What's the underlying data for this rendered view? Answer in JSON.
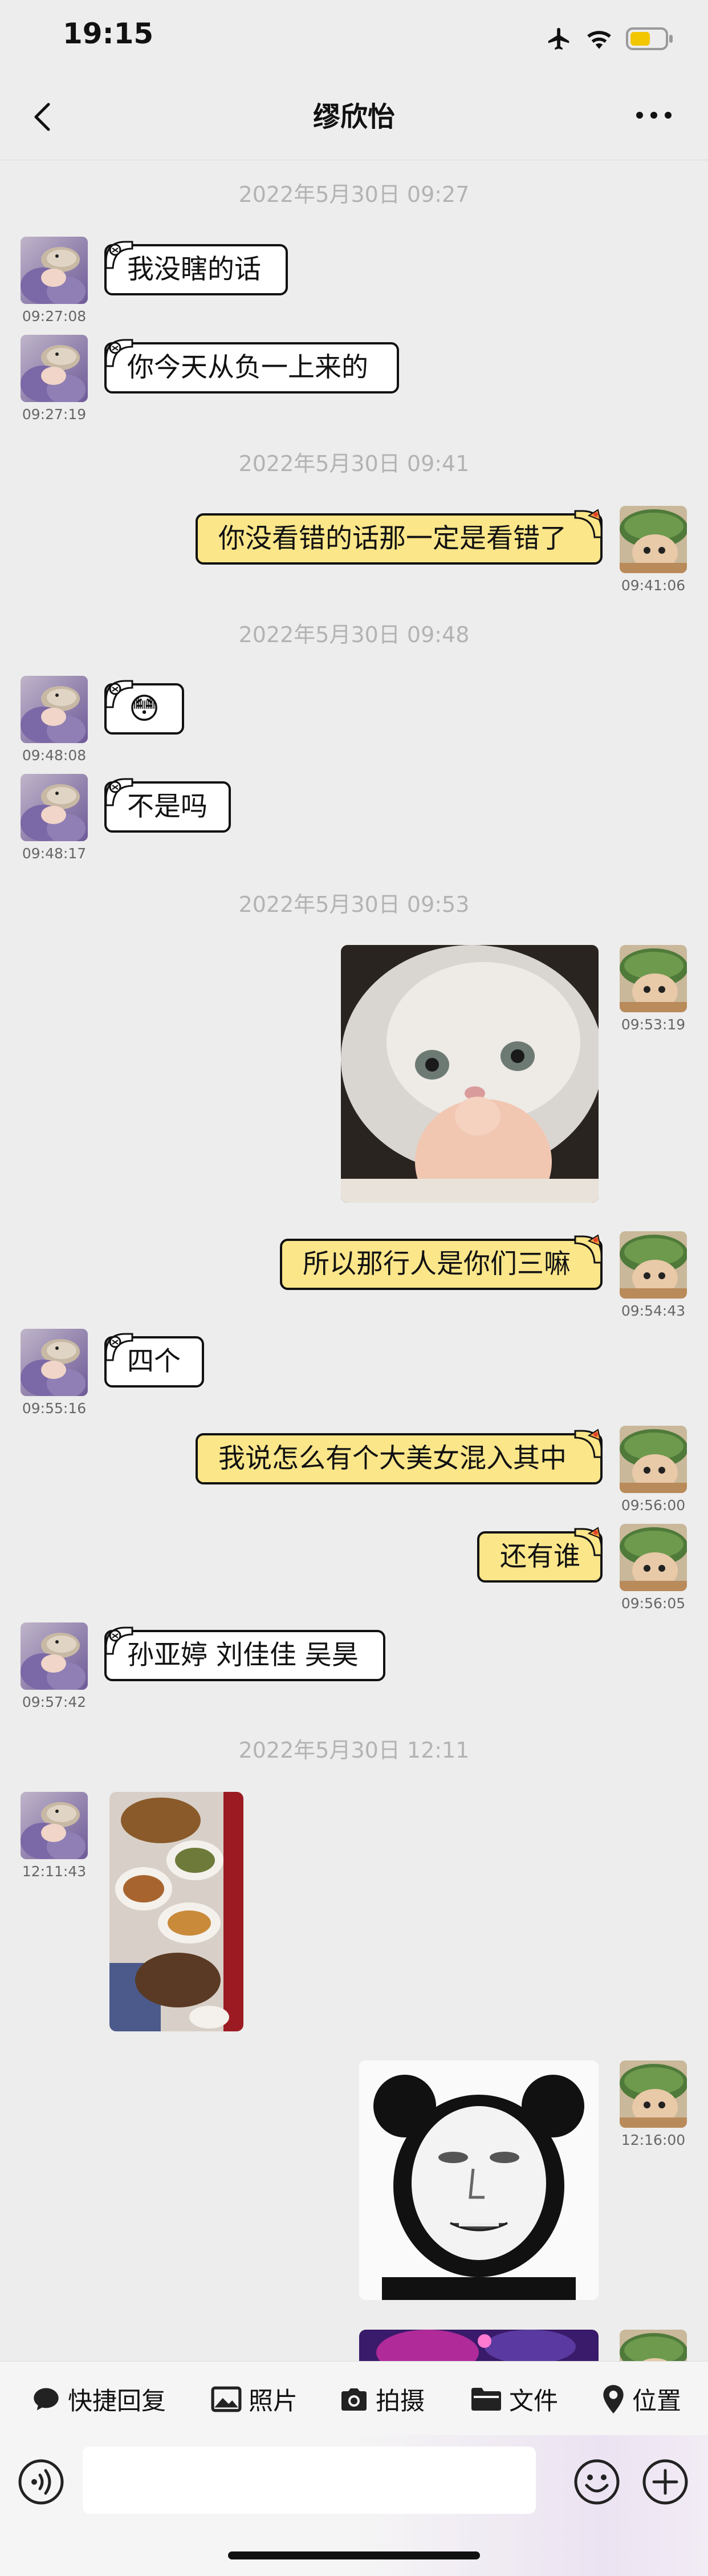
{
  "status": {
    "time": "19:15"
  },
  "nav": {
    "title": "缪欣怡"
  },
  "timestamps": [
    "2022年5月30日 09:27",
    "2022年5月30日 09:41",
    "2022年5月30日 09:48",
    "2022年5月30日 09:53",
    "2022年5月30日 12:11"
  ],
  "messages": [
    {
      "side": "left",
      "type": "text",
      "text": "我没瞎的话",
      "time": "09:27:08"
    },
    {
      "side": "left",
      "type": "text",
      "text": "你今天从负一上来的",
      "time": "09:27:19"
    },
    {
      "side": "right",
      "type": "text",
      "text": "你没看错的话那一定是看错了",
      "time": "09:41:06"
    },
    {
      "side": "left",
      "type": "emoji",
      "text": "😳",
      "time": "09:48:08"
    },
    {
      "side": "left",
      "type": "text",
      "text": "不是吗",
      "time": "09:48:17"
    },
    {
      "side": "right",
      "type": "image",
      "subject": "cat-pointing-sticker",
      "time": "09:53:19"
    },
    {
      "side": "right",
      "type": "text",
      "text": "所以那行人是你们三嘛",
      "time": "09:54:43"
    },
    {
      "side": "left",
      "type": "text",
      "text": "四个",
      "time": "09:55:16"
    },
    {
      "side": "right",
      "type": "text",
      "text": "我说怎么有个大美女混入其中",
      "time": "09:56:00"
    },
    {
      "side": "right",
      "type": "text",
      "text": "还有谁",
      "time": "09:56:05"
    },
    {
      "side": "left",
      "type": "text",
      "text": "孙亚婷 刘佳佳 吴昊",
      "time": "09:57:42"
    },
    {
      "side": "left",
      "type": "image",
      "subject": "food-table-photo",
      "time": "12:11:43"
    },
    {
      "side": "right",
      "type": "image",
      "subject": "panda-meme-sticker",
      "time": "12:16:00"
    },
    {
      "side": "right",
      "type": "image",
      "subject": "partial-purple-image",
      "time": ""
    }
  ],
  "toolbar": {
    "quick_reply": "快捷回复",
    "photo": "照片",
    "camera": "拍摄",
    "file": "文件",
    "location": "位置"
  },
  "input": {
    "placeholder": ""
  },
  "colors": {
    "background": "#ededed",
    "bubble_right": "#fbe68a",
    "bubble_left": "#ffffff",
    "timestamp": "#b3b3b3"
  }
}
